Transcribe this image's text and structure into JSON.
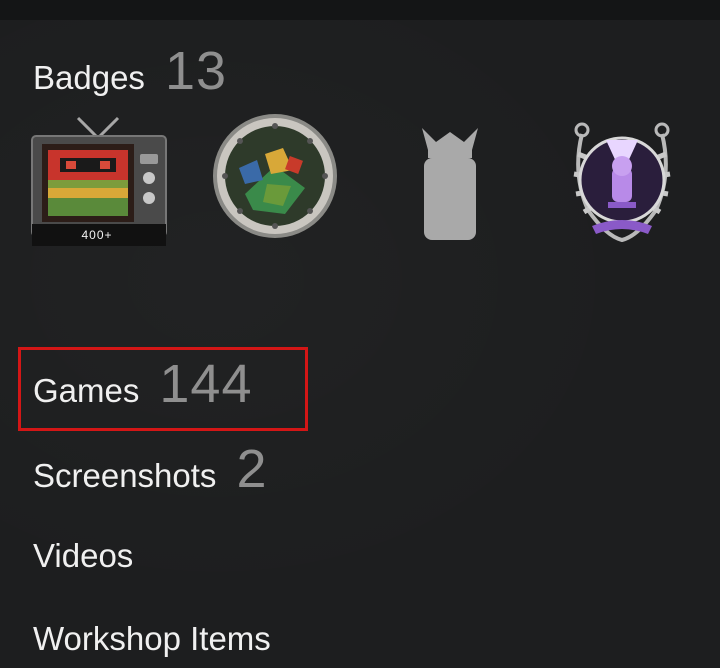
{
  "badges": {
    "label": "Badges",
    "count": "13",
    "items": [
      {
        "icon": "tv-badge-icon",
        "caption": "400+"
      },
      {
        "icon": "porthole-badge-icon"
      },
      {
        "icon": "bottle-badge-icon"
      },
      {
        "icon": "trophy-badge-icon"
      }
    ]
  },
  "games": {
    "label": "Games",
    "count": "144"
  },
  "screenshots": {
    "label": "Screenshots",
    "count": "2"
  },
  "videos": {
    "label": "Videos"
  },
  "workshop": {
    "label": "Workshop Items"
  },
  "colors": {
    "background": "#1d1e1f",
    "highlight_border": "#d31616",
    "label_text": "#f0f0f0",
    "count_text": "#8f8f8f"
  }
}
